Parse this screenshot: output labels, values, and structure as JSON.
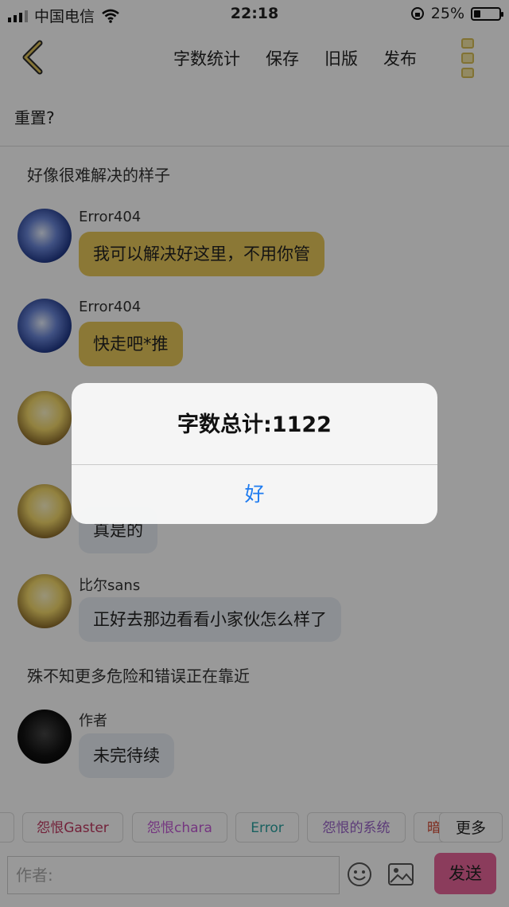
{
  "status": {
    "carrier": "中国电信",
    "time": "22:18",
    "battery": "25%",
    "battery_level": 0.25
  },
  "nav": {
    "actions": [
      "字数统计",
      "保存",
      "旧版",
      "发布"
    ]
  },
  "title": "重置?",
  "messages": {
    "narr1": "好像很难解决的样子",
    "m1": {
      "name": "Error404",
      "text": "我可以解决好这里，不用你管"
    },
    "m2": {
      "name": "Error404",
      "text": "快走吧*推"
    },
    "m4": {
      "text": "真是的"
    },
    "m5": {
      "name": "比尔sans",
      "text": "正好去那边看看小家伙怎么样了"
    },
    "narr2": "殊不知更多危险和错误正在靠近",
    "m6": {
      "name": "作者",
      "text": "未完待续"
    }
  },
  "tags": [
    {
      "label": "怨恨Gaster",
      "color": "#c03a62"
    },
    {
      "label": "怨恨chara",
      "color": "#c35bd6"
    },
    {
      "label": "Error",
      "color": "#2aa2a0"
    },
    {
      "label": "怨恨的系统",
      "color": "#9a63c9"
    },
    {
      "label": "暗",
      "color": "#d1442c"
    }
  ],
  "more_label": "更多",
  "input": {
    "placeholder": "作者:"
  },
  "send_label": "发送",
  "dialog": {
    "message": "字数总计:1122",
    "ok": "好"
  }
}
